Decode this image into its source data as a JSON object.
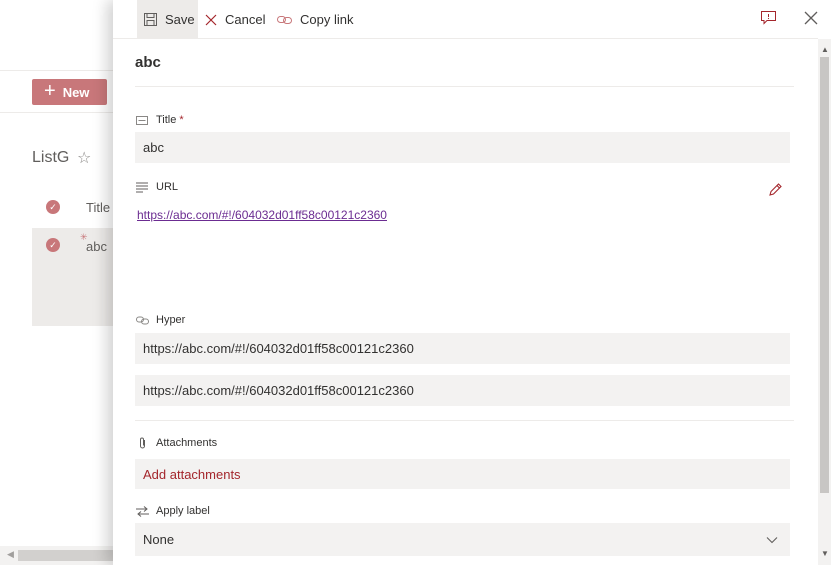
{
  "background": {
    "new_button": "New",
    "list_title": "ListG",
    "column_title": "Title",
    "row_value": "abc",
    "spark": "✳"
  },
  "toolbar": {
    "save": "Save",
    "cancel": "Cancel",
    "copy_link": "Copy link"
  },
  "item": {
    "heading": "abc"
  },
  "fields": {
    "title": {
      "label": "Title",
      "required_mark": "*",
      "value": "abc"
    },
    "url": {
      "label": "URL",
      "value": "https://abc.com/#!/604032d01ff58c00121c2360"
    },
    "hyper": {
      "label": "Hyper",
      "address": "https://abc.com/#!/604032d01ff58c00121c2360",
      "description": "https://abc.com/#!/604032d01ff58c00121c2360"
    },
    "attachments": {
      "label": "Attachments",
      "action": "Add attachments"
    },
    "apply_label": {
      "label": "Apply label",
      "value": "None"
    }
  },
  "colors": {
    "accent": "#c8777a",
    "required": "#a4262c",
    "link_visited": "#6b2c91"
  }
}
